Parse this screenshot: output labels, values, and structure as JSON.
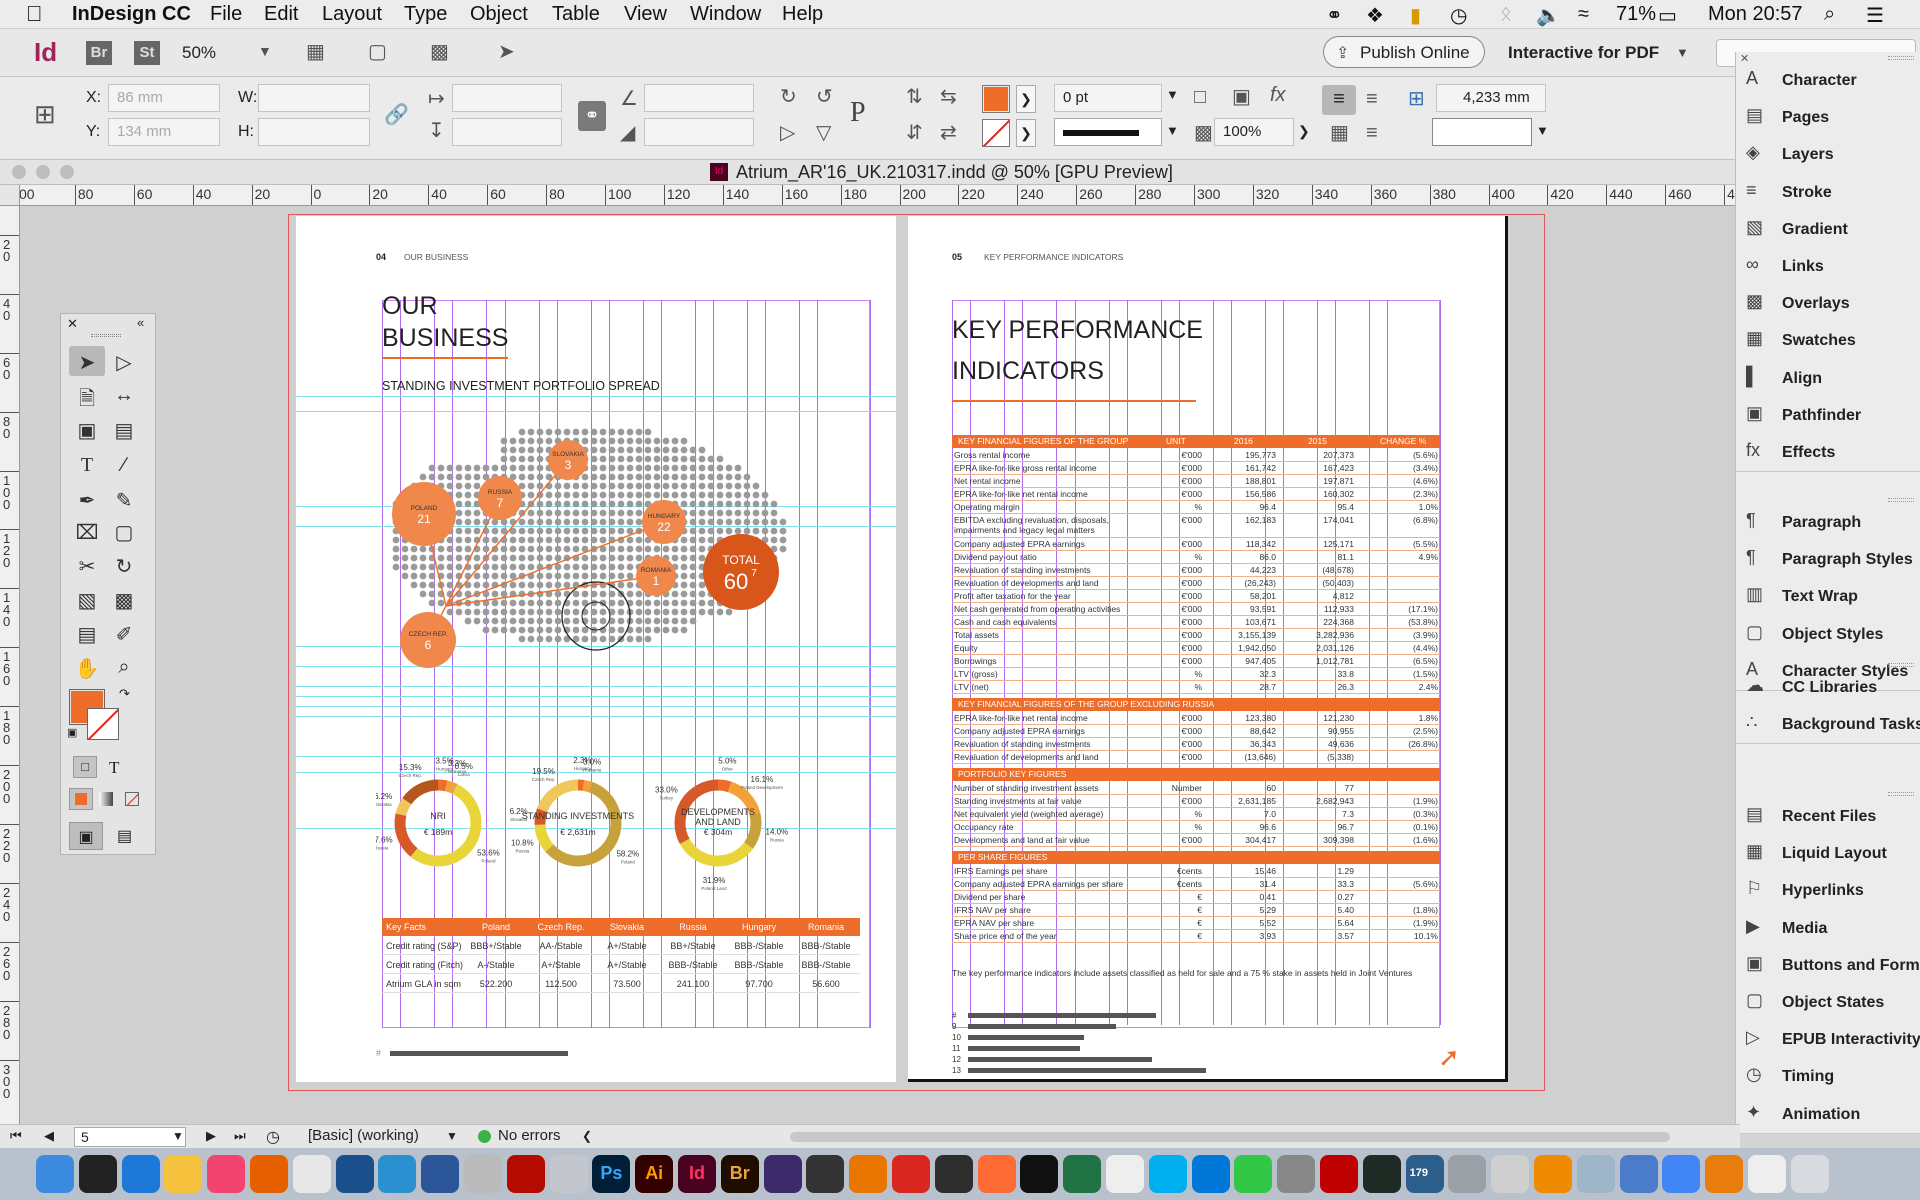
{
  "menubar": {
    "app": "InDesign CC",
    "items": [
      "File",
      "Edit",
      "Layout",
      "Type",
      "Object",
      "Table",
      "View",
      "Window",
      "Help"
    ],
    "battery": "71%",
    "clock": "Mon 20:57"
  },
  "appbar": {
    "logo": "Id",
    "bridge": "Br",
    "stock": "St",
    "zoom": "50%",
    "publish": "Publish Online",
    "workspace": "Interactive for PDF"
  },
  "ctrl": {
    "x_label": "X:",
    "y_label": "Y:",
    "w_label": "W:",
    "h_label": "H:",
    "x_val": "86 mm",
    "y_val": "134 mm",
    "stroke_weight": "0 pt",
    "opacity": "100%",
    "gap": "4,233 mm",
    "fill_color": "#ee6d2a"
  },
  "document": {
    "title": "Atrium_AR'16_UK.210317.indd @ 50% [GPU Preview]"
  },
  "hruler": [
    "00",
    "80",
    "60",
    "40",
    "20",
    "0",
    "20",
    "40",
    "60",
    "80",
    "100",
    "120",
    "140",
    "160",
    "180",
    "200",
    "220",
    "240",
    "260",
    "280",
    "300",
    "320",
    "340",
    "360",
    "380",
    "400",
    "420",
    "440",
    "460",
    "480"
  ],
  "vruler": [
    "0",
    "20",
    "40",
    "60",
    "80",
    "100",
    "120",
    "140",
    "160",
    "180",
    "200",
    "220",
    "240",
    "260",
    "280",
    "300"
  ],
  "left_page": {
    "folio": "04",
    "section": "OUR BUSINESS",
    "title_l1": "OUR",
    "title_l2": "BUSINESS",
    "subtitle": "STANDING INVESTMENT PORTFOLIO SPREAD",
    "bubbles": [
      {
        "name": "POLAND",
        "value": "21"
      },
      {
        "name": "RUSSIA",
        "value": "7"
      },
      {
        "name": "SLOVAKIA",
        "value": "3"
      },
      {
        "name": "HUNGARY",
        "value": "22"
      },
      {
        "name": "ROMANIA",
        "value": "1"
      },
      {
        "name": "CZECH REP.",
        "value": "6"
      }
    ],
    "total_label": "TOTAL",
    "total_value": "60",
    "total_sup": "7",
    "donuts": [
      {
        "title": "NRI",
        "value": "€ 189m",
        "labels": [
          "3.5%",
          "3.3%",
          "0.5%",
          "53.6%",
          "17.6%",
          "6.2%",
          "15.3%"
        ],
        "sublabels": [
          "Hungary",
          "Romania",
          "Latvia",
          "Poland",
          "Russia",
          "Slovakia",
          "Czech Rep."
        ]
      },
      {
        "title": "STANDING INVESTMENTS",
        "value": "€ 2,631m",
        "labels": [
          "2.3%",
          "3.0%",
          "58.2%",
          "10.8%",
          "6.2%",
          "19.5%"
        ],
        "sublabels": [
          "Hungary",
          "Romania",
          "Poland",
          "Russia",
          "Slovakia",
          "Czech Rep."
        ]
      },
      {
        "title": "DEVELOPMENTS AND LAND",
        "value": "€ 304m",
        "labels": [
          "5.0%",
          "16.1%",
          "14.0%",
          "31.9%",
          "33.0%"
        ],
        "sublabels": [
          "Other",
          "Poland Development",
          "Russia",
          "Poland Land",
          "Turkey"
        ]
      }
    ],
    "keyfacts": {
      "headers": [
        "Key Facts",
        "Poland",
        "Czech Rep.",
        "Slovakia",
        "Russia",
        "Hungary",
        "Romania"
      ],
      "rows": [
        [
          "Credit rating (S&P)",
          "BBB+/Stable",
          "AA-/Stable",
          "A+/Stable",
          "BB+/Stable",
          "BBB-/Stable",
          "BBB-/Stable"
        ],
        [
          "Credit rating (Fitch)",
          "A-/Stable",
          "A+/Stable",
          "A+/Stable",
          "BBB-/Stable",
          "BBB-/Stable",
          "BBB-/Stable"
        ],
        [
          "Atrium GLA in sqm",
          "522.200",
          "112.500",
          "73.500",
          "241.100",
          "97.700",
          "56.600"
        ]
      ]
    }
  },
  "right_page": {
    "folio": "05",
    "section": "KEY PERFORMANCE INDICATORS",
    "title_l1": "KEY PERFORMANCE",
    "title_l2": "INDICATORS",
    "col_unit": "UNIT",
    "col_2016": "2016",
    "col_2015": "2015",
    "col_change": "CHANGE %",
    "sections": [
      {
        "head": "KEY FINANCIAL FIGURES OF THE GROUP",
        "rows": [
          [
            "Gross rental income",
            "€'000",
            "195,773",
            "207,373",
            "(5.6%)"
          ],
          [
            "EPRA like-for-like gross rental income",
            "€'000",
            "161,742",
            "167,423",
            "(3.4%)"
          ],
          [
            "Net rental income",
            "€'000",
            "188,801",
            "197,871",
            "(4.6%)"
          ],
          [
            "EPRA like-for-like net rental income",
            "€'000",
            "156,586",
            "160,302",
            "(2.3%)"
          ],
          [
            "Operating margin",
            "%",
            "96.4",
            "95.4",
            "1.0%"
          ],
          [
            "EBITDA excluding revaluation, disposals, impairments and legacy legal matters",
            "€'000",
            "162,183",
            "174,041",
            "(6.8%)"
          ],
          [
            "Company adjusted EPRA earnings",
            "€'000",
            "118,342",
            "125,171",
            "(5.5%)"
          ],
          [
            "Dividend pay-out ratio",
            "%",
            "86.0",
            "81.1",
            "4.9%"
          ],
          [
            "Revaluation of standing investments",
            "€'000",
            "44,223",
            "(48,678)",
            ""
          ],
          [
            "Revaluation of developments and land",
            "€'000",
            "(26,243)",
            "(50,403)",
            ""
          ],
          [
            "Profit after taxation for the year",
            "€'000",
            "58,201",
            "4,812",
            ""
          ],
          [
            "Net cash generated from operating activities",
            "€'000",
            "93,591",
            "112,933",
            "(17.1%)"
          ],
          [
            "Cash and cash equivalents",
            "€'000",
            "103,671",
            "224,368",
            "(53.8%)"
          ],
          [
            "Total assets",
            "€'000",
            "3,155,139",
            "3,282,936",
            "(3.9%)"
          ],
          [
            "Equity",
            "€'000",
            "1,942,050",
            "2,031,126",
            "(4.4%)"
          ],
          [
            "Borrowings",
            "€'000",
            "947,405",
            "1,012,781",
            "(6.5%)"
          ],
          [
            "LTV (gross)",
            "%",
            "32.3",
            "33.8",
            "(1.5%)"
          ],
          [
            "LTV (net)",
            "%",
            "28.7",
            "26.3",
            "2.4%"
          ]
        ]
      },
      {
        "head": "KEY FINANCIAL FIGURES OF THE GROUP EXCLUDING RUSSIA",
        "rows": [
          [
            "EPRA like-for-like net rental income",
            "€'000",
            "123,380",
            "121,230",
            "1.8%"
          ],
          [
            "Company adjusted EPRA earnings",
            "€'000",
            "88,642",
            "90,955",
            "(2.5%)"
          ],
          [
            "Revaluation of standing investments",
            "€'000",
            "36,343",
            "49,636",
            "(26.8%)"
          ],
          [
            "Revaluation of developments and land",
            "€'000",
            "(13,646)",
            "(5,338)",
            ""
          ]
        ]
      },
      {
        "head": "PORTFOLIO KEY FIGURES",
        "rows": [
          [
            "Number of standing investment assets",
            "Number",
            "60",
            "77",
            ""
          ],
          [
            "Standing investments at fair value",
            "€'000",
            "2,631,185",
            "2,682,943",
            "(1.9%)"
          ],
          [
            "Net equivalent yield (weighted average)",
            "%",
            "7.0",
            "7.3",
            "(0.3%)"
          ],
          [
            "Occupancy rate",
            "%",
            "96.6",
            "96.7",
            "(0.1%)"
          ],
          [
            "Developments and land at fair value",
            "€'000",
            "304,417",
            "309,398",
            "(1.6%)"
          ]
        ]
      },
      {
        "head": "PER SHARE FIGURES",
        "rows": [
          [
            "IFRS Earnings per share",
            "€cents",
            "15.46",
            "1.29",
            ""
          ],
          [
            "Company adjusted EPRA earnings per share",
            "€cents",
            "31.4",
            "33.3",
            "(5.6%)"
          ],
          [
            "Dividend per share",
            "€",
            "0.41",
            "0.27",
            ""
          ],
          [
            "IFRS NAV per share",
            "€",
            "5.29",
            "5.40",
            "(1.8%)"
          ],
          [
            "EPRA NAV per share",
            "€",
            "5.52",
            "5.64",
            "(1.9%)"
          ],
          [
            "Share price end of the year",
            "€",
            "3.93",
            "3.57",
            "10.1%"
          ]
        ]
      }
    ],
    "footnote": "The key performance indicators include assets classified as held for sale and a 75 % stake in assets held in Joint Ventures",
    "footnote_nums": [
      "9",
      "10",
      "11",
      "12",
      "13"
    ]
  },
  "panel": {
    "group1": [
      "Character",
      "Pages",
      "Layers",
      "Stroke",
      "Gradient",
      "Links",
      "Overlays",
      "Swatches",
      "Align",
      "Pathfinder",
      "Effects"
    ],
    "group2": [
      "Paragraph",
      "Paragraph Styles",
      "Text Wrap",
      "Object Styles",
      "Character Styles"
    ],
    "group3": [
      "CC Libraries",
      "Background Tasks"
    ],
    "group4": [
      "Recent Files",
      "Liquid Layout",
      "Hyperlinks",
      "Media",
      "Buttons and Forms",
      "Object States",
      "EPUB Interactivity",
      "Timing",
      "Animation"
    ]
  },
  "status": {
    "page": "5",
    "style": "[Basic] (working)",
    "errors": "No errors"
  },
  "dock": {
    "ps": "Ps",
    "ai": "Ai",
    "id": "Id",
    "br": "Br",
    "badge": "179"
  }
}
